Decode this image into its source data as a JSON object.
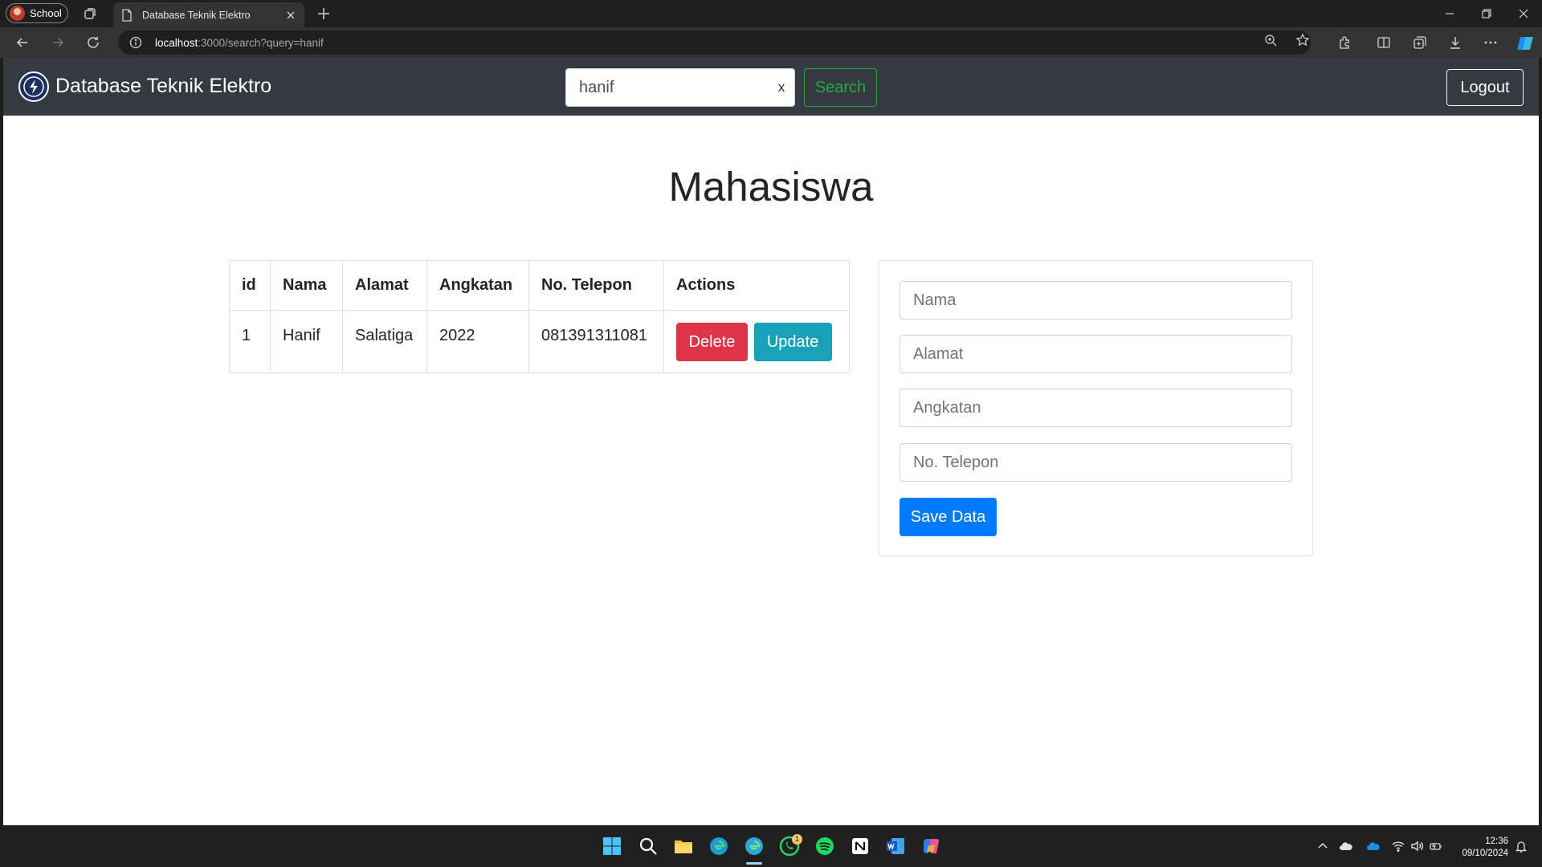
{
  "browser": {
    "profile_label": "School",
    "tab_title": "Database Teknik Elektro",
    "url_host": "localhost",
    "url_rest": ":3000/search?query=hanif"
  },
  "navbar": {
    "brand": "Database Teknik Elektro",
    "search_value": "hanif",
    "search_clear": "x",
    "search_button": "Search",
    "logout_button": "Logout"
  },
  "page": {
    "title": "Mahasiswa"
  },
  "table": {
    "headers": [
      "id",
      "Nama",
      "Alamat",
      "Angkatan",
      "No. Telepon",
      "Actions"
    ],
    "rows": [
      {
        "id": "1",
        "nama": "Hanif",
        "alamat": "Salatiga",
        "angkatan": "2022",
        "telepon": "081391311081"
      }
    ],
    "delete_label": "Delete",
    "update_label": "Update"
  },
  "form": {
    "nama_placeholder": "Nama",
    "alamat_placeholder": "Alamat",
    "angkatan_placeholder": "Angkatan",
    "telepon_placeholder": "No. Telepon",
    "save_label": "Save Data"
  },
  "taskbar": {
    "time": "12:36",
    "date": "09/10/2024",
    "whatsapp_badge": "1"
  },
  "colors": {
    "navbar_bg": "#343a40",
    "danger": "#dc3545",
    "info": "#17a2b8",
    "primary": "#007bff",
    "success": "#28a745"
  }
}
